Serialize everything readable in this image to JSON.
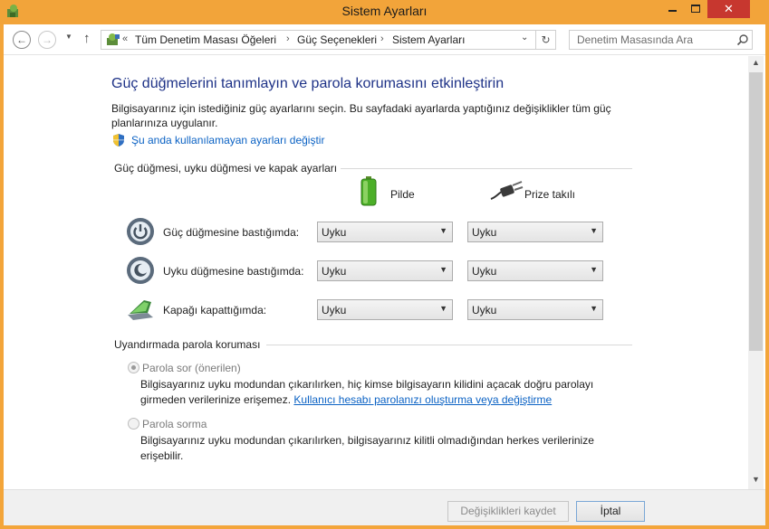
{
  "window": {
    "title": "Sistem Ayarları",
    "close_glyph": "✕"
  },
  "nav": {
    "back_glyph": "←",
    "forward_glyph": "→",
    "history_glyph": "▼",
    "up_glyph": "↑",
    "breadcrumb_prefix": "«",
    "breadcrumbs": [
      "Tüm Denetim Masası Öğeleri",
      "Güç Seçenekleri",
      "Sistem Ayarları"
    ],
    "crumb_sep": "›",
    "address_dropdown_glyph": "⌄",
    "refresh_glyph": "↻",
    "search_placeholder": "Denetim Masasında Ara"
  },
  "page": {
    "heading": "Güç düğmelerini tanımlayın ve parola korumasını etkinleştirin",
    "description": "Bilgisayarınız için istediğiniz güç ayarlarını seçin. Bu sayfadaki ayarlarda yaptığınız değişiklikler tüm güç planlarınıza uygulanır.",
    "unavailable_link": "Şu anda kullanılamayan ayarları değiştir",
    "buttons_section_title": "Güç düğmesi, uyku düğmesi ve kapak ayarları",
    "col_battery": "Pilde",
    "col_plugged": "Prize takılı",
    "rows": [
      {
        "label": "Güç düğmesine bastığımda:",
        "battery": "Uyku",
        "plugged": "Uyku"
      },
      {
        "label": "Uyku düğmesine bastığımda:",
        "battery": "Uyku",
        "plugged": "Uyku"
      },
      {
        "label": "Kapağı kapattığımda:",
        "battery": "Uyku",
        "plugged": "Uyku"
      }
    ],
    "dropdown_arrow": "▼",
    "password_section_title": "Uyandırmada parola koruması",
    "option_ask_label": "Parola sor (önerilen)",
    "option_ask_desc": "Bilgisayarınız uyku modundan çıkarılırken, hiç kimse bilgisayarın kilidini açacak doğru parolayı girmeden verilerinize erişemez.",
    "option_ask_link": "Kullanıcı hesabı parolanızı oluşturma veya değiştirme",
    "option_noask_label": "Parola sorma",
    "option_noask_desc": "Bilgisayarınız uyku modundan çıkarılırken, bilgisayarınız kilitli olmadığından herkes verilerinize erişebilir."
  },
  "scrollbar": {
    "up_glyph": "▲",
    "down_glyph": "▼"
  },
  "footer": {
    "save_label": "Değişiklikleri kaydet",
    "cancel_label": "İptal"
  },
  "colors": {
    "titlebar": "#f2a43a",
    "close_button": "#c7372f",
    "heading": "#1e3287",
    "link": "#0b62c4"
  }
}
